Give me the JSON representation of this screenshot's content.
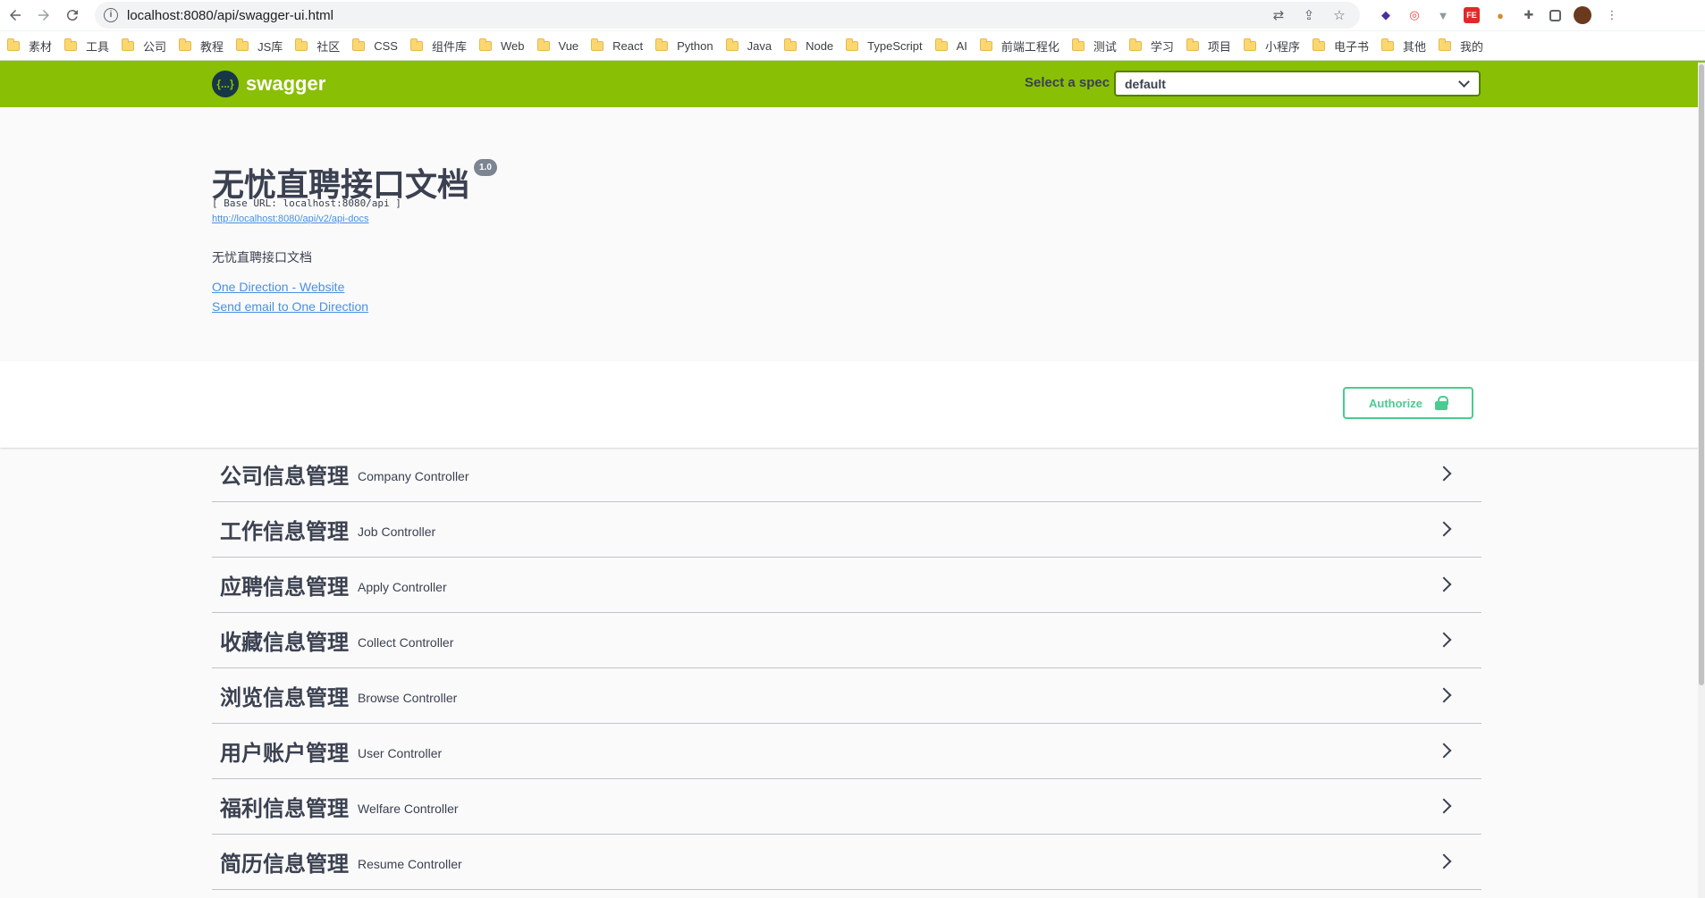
{
  "browser": {
    "url": "localhost:8080/api/swagger-ui.html",
    "bookmarks": [
      "素材",
      "工具",
      "公司",
      "教程",
      "JS库",
      "社区",
      "CSS",
      "组件库",
      "Web",
      "Vue",
      "React",
      "Python",
      "Java",
      "Node",
      "TypeScript",
      "AI",
      "前端工程化",
      "测试",
      "学习",
      "项目",
      "小程序",
      "电子书",
      "其他",
      "我的"
    ]
  },
  "topbar": {
    "logo_text": "swagger",
    "logo_mark": "{...}",
    "spec_label": "Select a spec",
    "spec_value": "default"
  },
  "info": {
    "title": "无忧直聘接口文档",
    "version": "1.0",
    "base_url": "[ Base URL: localhost:8080/api ]",
    "api_docs_link": "http://localhost:8080/api/v2/api-docs",
    "description": "无忧直聘接口文档",
    "website_link": "One Direction - Website",
    "email_link": "Send email to One Direction"
  },
  "auth": {
    "label": "Authorize"
  },
  "tags": [
    {
      "name": "公司信息管理",
      "desc": "Company Controller"
    },
    {
      "name": "工作信息管理",
      "desc": "Job Controller"
    },
    {
      "name": "应聘信息管理",
      "desc": "Apply Controller"
    },
    {
      "name": "收藏信息管理",
      "desc": "Collect Controller"
    },
    {
      "name": "浏览信息管理",
      "desc": "Browse Controller"
    },
    {
      "name": "用户账户管理",
      "desc": "User Controller"
    },
    {
      "name": "福利信息管理",
      "desc": "Welfare Controller"
    },
    {
      "name": "简历信息管理",
      "desc": "Resume Controller"
    }
  ],
  "colors": {
    "topbar": "#89bf04",
    "authorize": "#49cc90",
    "link": "#4990e2"
  }
}
